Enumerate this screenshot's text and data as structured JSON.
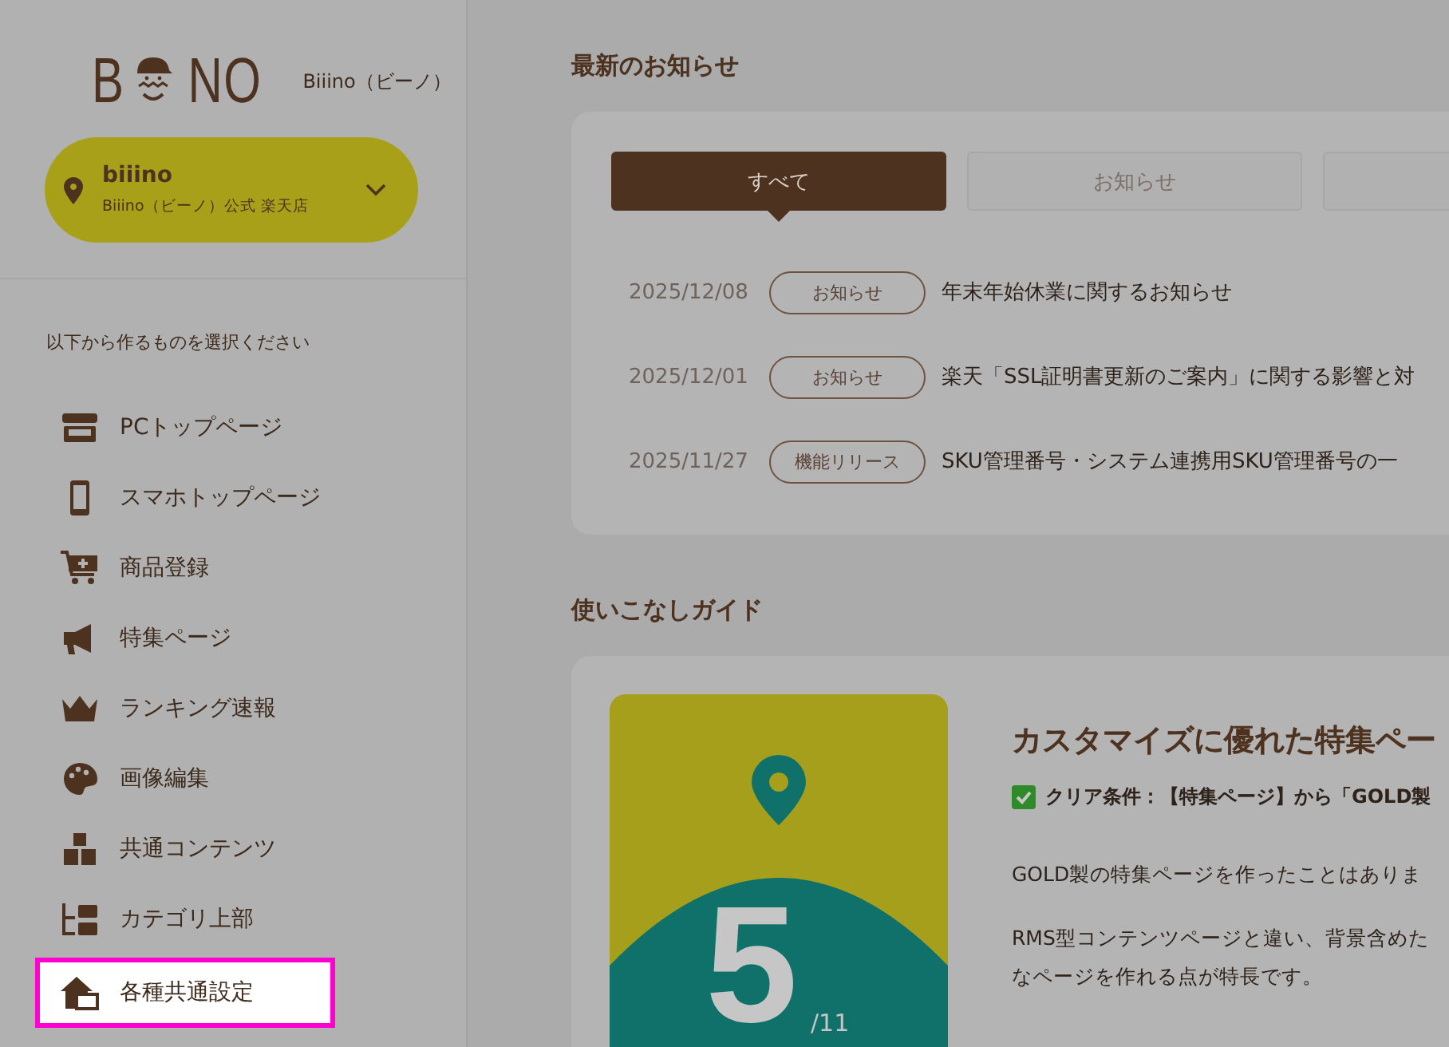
{
  "logo": {
    "left": "B",
    "right": "NO",
    "caption": "Biiino（ビーノ）"
  },
  "store": {
    "name": "biiino",
    "subtitle": "Biiino（ビーノ）公式 楽天店"
  },
  "sidebar": {
    "prompt": "以下から作るものを選択ください",
    "items": [
      {
        "label": "PCトップページ",
        "kind": "store",
        "highlighted": false
      },
      {
        "label": "スマホトップページ",
        "kind": "phone",
        "highlighted": false
      },
      {
        "label": "商品登録",
        "kind": "cart",
        "highlighted": false
      },
      {
        "label": "特集ページ",
        "kind": "megaphone",
        "highlighted": false
      },
      {
        "label": "ランキング速報",
        "kind": "crown",
        "highlighted": false
      },
      {
        "label": "画像編集",
        "kind": "palette",
        "highlighted": false
      },
      {
        "label": "共通コンテンツ",
        "kind": "boxes",
        "highlighted": false
      },
      {
        "label": "カテゴリ上部",
        "kind": "tree",
        "highlighted": false
      },
      {
        "label": "各種共通設定",
        "kind": "house",
        "highlighted": true
      }
    ]
  },
  "news": {
    "title": "最新のお知らせ",
    "tabs": [
      {
        "label": "すべて",
        "selected": true
      },
      {
        "label": "お知らせ",
        "selected": false
      },
      {
        "selected": false
      }
    ],
    "rows": [
      {
        "date": "2025/12/08",
        "tag": "お知らせ",
        "title": "年末年始休業に関するお知らせ"
      },
      {
        "date": "2025/12/01",
        "tag": "お知らせ",
        "title": "楽天「SSL証明書更新のご案内」に関する影響と対"
      },
      {
        "date": "2025/11/27",
        "tag": "機能リリース",
        "title": "SKU管理番号・システム連携用SKU管理番号の一"
      }
    ]
  },
  "guide": {
    "title": "使いこなしガイド",
    "step": "5",
    "total": "/11",
    "card_title": "カスタマイズに優れた特集ペー",
    "condition": "クリア条件：【特集ページ】から「GOLD製",
    "paragraphs": [
      [
        "GOLD製の特集ページを作ったことはありま"
      ],
      [
        "RMS型コンテンツページと違い、背景含めた",
        "なページを作れる点が特長です。"
      ]
    ]
  }
}
